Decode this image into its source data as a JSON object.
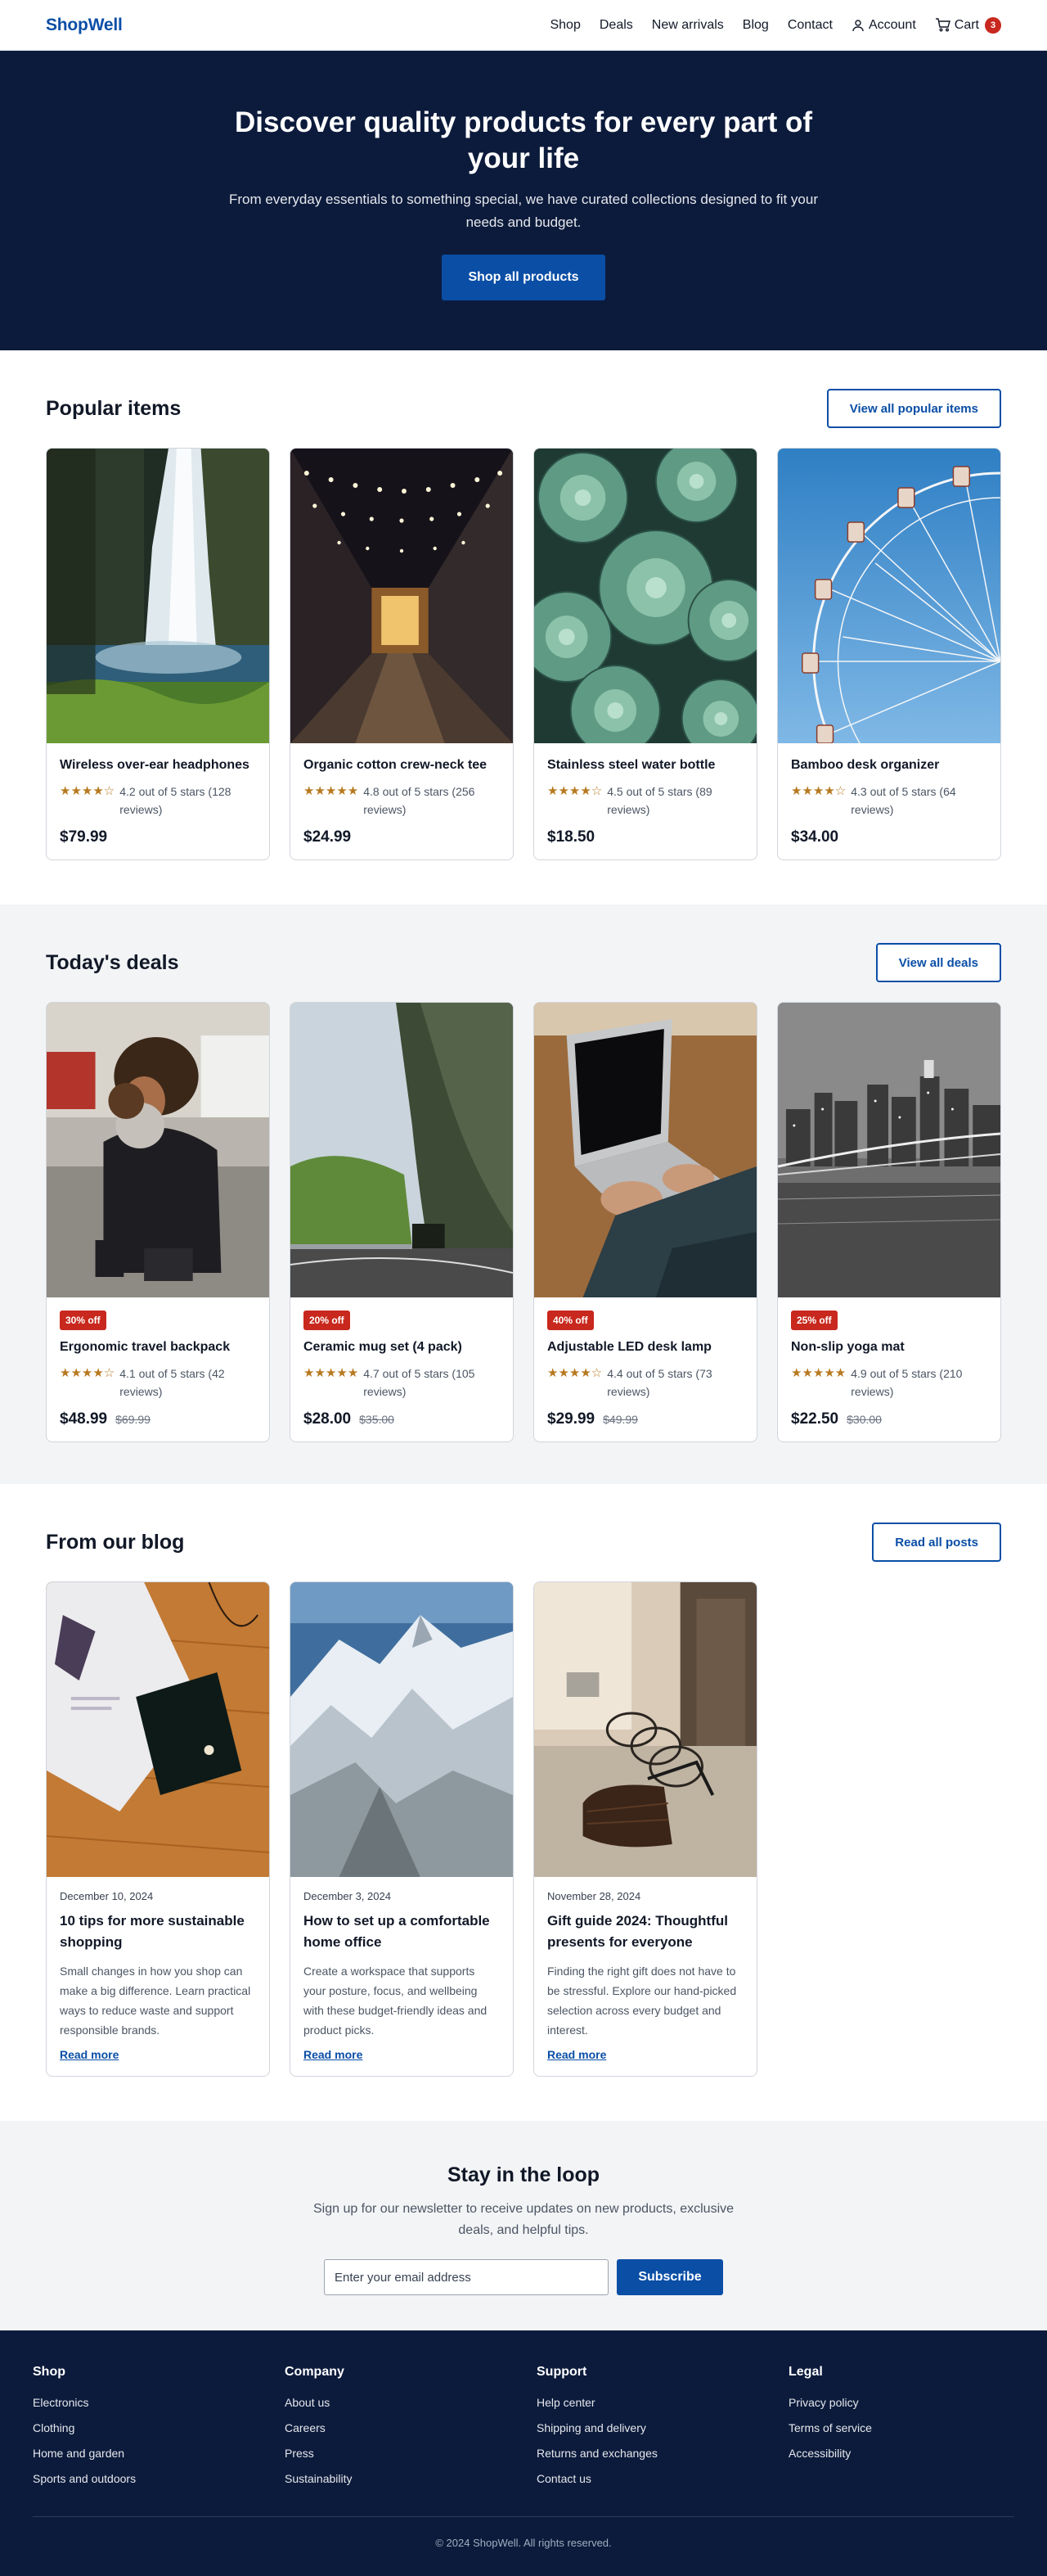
{
  "header": {
    "logo": "ShopWell",
    "nav": [
      "Shop",
      "Deals",
      "New arrivals",
      "Blog",
      "Contact"
    ],
    "account_label": "Account",
    "cart_label": "Cart",
    "cart_count": "3"
  },
  "hero": {
    "title": "Discover quality products for every part of your life",
    "subtitle": "From everyday essentials to something special, we have curated collections designed to fit your needs and budget.",
    "cta": "Shop all products"
  },
  "popular": {
    "heading": "Popular items",
    "view_all": "View all popular items",
    "items": [
      {
        "title": "Wireless over-ear headphones",
        "stars": "★★★★☆",
        "rating": "4.2 out of 5 stars (128 reviews)",
        "price": "$79.99",
        "image": "waterfall"
      },
      {
        "title": "Organic cotton crew-neck tee",
        "stars": "★★★★★",
        "rating": "4.8 out of 5 stars (256 reviews)",
        "price": "$24.99",
        "image": "night-street-lights"
      },
      {
        "title": "Stainless steel water bottle",
        "stars": "★★★★☆",
        "rating": "4.5 out of 5 stars (89 reviews)",
        "price": "$18.50",
        "image": "succulents"
      },
      {
        "title": "Bamboo desk organizer",
        "stars": "★★★★☆",
        "rating": "4.3 out of 5 stars (64 reviews)",
        "price": "$34.00",
        "image": "ferris-wheel"
      }
    ]
  },
  "deals": {
    "heading": "Today's deals",
    "view_all": "View all deals",
    "items": [
      {
        "tag": "30% off",
        "title": "Ergonomic travel backpack",
        "stars": "★★★★☆",
        "rating": "4.1 out of 5 stars (42 reviews)",
        "price": "$48.99",
        "old_price": "$69.99",
        "image": "mother-child-street"
      },
      {
        "tag": "20% off",
        "title": "Ceramic mug set (4 pack)",
        "stars": "★★★★★",
        "rating": "4.7 out of 5 stars (105 reviews)",
        "price": "$28.00",
        "old_price": "$35.00",
        "image": "mountain-road-tunnel"
      },
      {
        "tag": "40% off",
        "title": "Adjustable LED desk lamp",
        "stars": "★★★★☆",
        "rating": "4.4 out of 5 stars (73 reviews)",
        "price": "$29.99",
        "old_price": "$49.99",
        "image": "laptop-typing"
      },
      {
        "tag": "25% off",
        "title": "Non-slip yoga mat",
        "stars": "★★★★★",
        "rating": "4.9 out of 5 stars (210 reviews)",
        "price": "$22.50",
        "old_price": "$30.00",
        "image": "city-bridge-night"
      }
    ]
  },
  "blog": {
    "heading": "From our blog",
    "view_all": "Read all posts",
    "posts": [
      {
        "date": "December 10, 2024",
        "title": "10 tips for more sustainable shopping",
        "excerpt": "Small changes in how you shop can make a big difference. Learn practical ways to reduce waste and support responsible brands.",
        "link": "Read more",
        "image": "magazine-on-table"
      },
      {
        "date": "December 3, 2024",
        "title": "How to set up a comfortable home office",
        "excerpt": "Create a workspace that supports your posture, focus, and wellbeing with these budget-friendly ideas and product picks.",
        "link": "Read more",
        "image": "snowy-mountains"
      },
      {
        "date": "November 28, 2024",
        "title": "Gift guide 2024: Thoughtful presents for everyone",
        "excerpt": "Finding the right gift does not have to be stressful. Explore our hand-picked selection across every budget and interest.",
        "link": "Read more",
        "image": "bicycles-street"
      }
    ]
  },
  "newsletter": {
    "heading": "Stay in the loop",
    "text": "Sign up for our newsletter to receive updates on new products, exclusive deals, and helpful tips.",
    "placeholder": "Enter your email address",
    "button": "Subscribe"
  },
  "footer": {
    "columns": [
      {
        "title": "Shop",
        "links": [
          "Electronics",
          "Clothing",
          "Home and garden",
          "Sports and outdoors"
        ]
      },
      {
        "title": "Company",
        "links": [
          "About us",
          "Careers",
          "Press",
          "Sustainability"
        ]
      },
      {
        "title": "Support",
        "links": [
          "Help center",
          "Shipping and delivery",
          "Returns and exchanges",
          "Contact us"
        ]
      },
      {
        "title": "Legal",
        "links": [
          "Privacy policy",
          "Terms of service",
          "Accessibility"
        ]
      }
    ],
    "copyright": "© 2024 ShopWell. All rights reserved."
  },
  "colors": {
    "brand": "#0a4ea6",
    "dark": "#0c1b3c",
    "deal_red": "#c8281d",
    "star": "#b7791f"
  }
}
